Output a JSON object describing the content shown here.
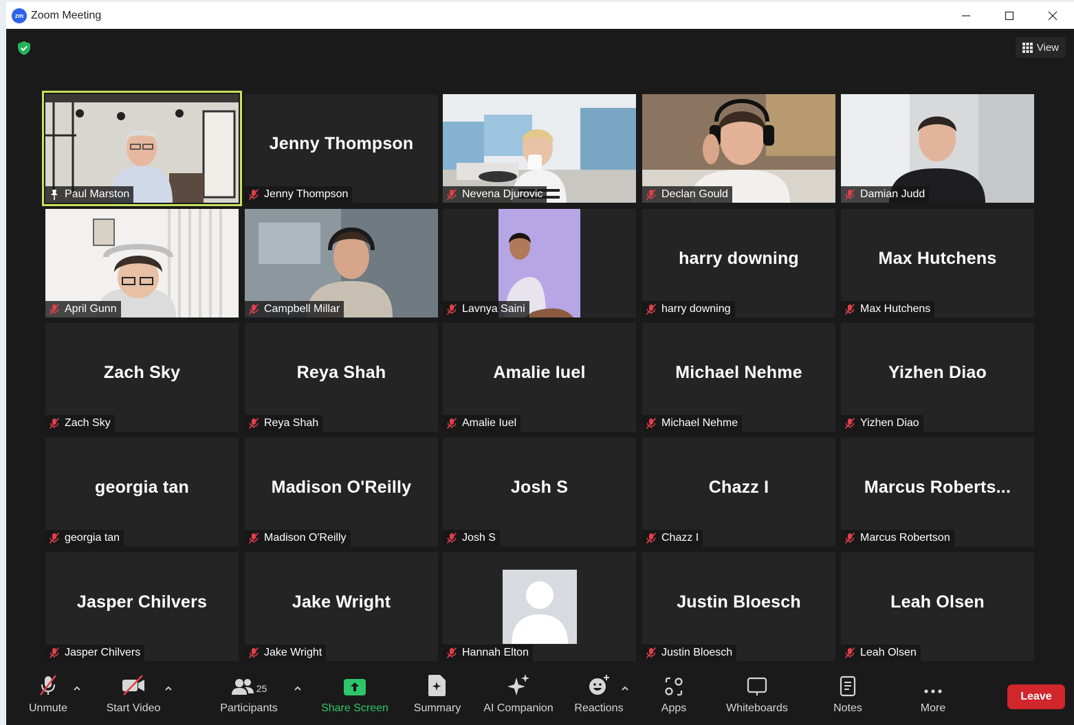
{
  "window": {
    "title": "Zoom Meeting"
  },
  "view_button": {
    "label": "View"
  },
  "participants_grid": [
    {
      "display": "",
      "label": "Paul Marston",
      "video": "room",
      "pinned": true,
      "active": true
    },
    {
      "display": "Jenny Thompson",
      "label": "Jenny Thompson",
      "video": "",
      "muted": true
    },
    {
      "display": "",
      "label": "Nevena Djurovic",
      "video": "bright",
      "muted": true
    },
    {
      "display": "",
      "label": "Declan Gould",
      "video": "warm",
      "muted": true
    },
    {
      "display": "",
      "label": "Damian Judd",
      "video": "grey",
      "muted": true
    },
    {
      "display": "",
      "label": "April Gunn",
      "video": "white",
      "muted": true
    },
    {
      "display": "",
      "label": "Campbell Millar",
      "video": "blur",
      "muted": true
    },
    {
      "display": "",
      "label": "Lavnya Saini",
      "video": "portrait",
      "muted": true
    },
    {
      "display": "harry downing",
      "label": "harry downing",
      "video": "",
      "muted": true
    },
    {
      "display": "Max Hutchens",
      "label": "Max Hutchens",
      "video": "",
      "muted": true
    },
    {
      "display": "Zach Sky",
      "label": "Zach Sky",
      "video": "",
      "muted": true
    },
    {
      "display": "Reya Shah",
      "label": "Reya Shah",
      "video": "",
      "muted": true
    },
    {
      "display": "Amalie Iuel",
      "label": "Amalie Iuel",
      "video": "",
      "muted": true
    },
    {
      "display": "Michael Nehme",
      "label": "Michael Nehme",
      "video": "",
      "muted": true
    },
    {
      "display": "Yizhen Diao",
      "label": "Yizhen Diao",
      "video": "",
      "muted": true
    },
    {
      "display": "georgia tan",
      "label": "georgia tan",
      "video": "",
      "muted": true
    },
    {
      "display": "Madison O'Reilly",
      "label": "Madison O'Reilly",
      "video": "",
      "muted": true
    },
    {
      "display": "Josh S",
      "label": "Josh S",
      "video": "",
      "muted": true
    },
    {
      "display": "Chazz I",
      "label": "Chazz I",
      "video": "",
      "muted": true
    },
    {
      "display": "Marcus Roberts...",
      "label": "Marcus Robertson",
      "video": "",
      "muted": true
    },
    {
      "display": "Jasper Chilvers",
      "label": "Jasper Chilvers",
      "video": "",
      "muted": true
    },
    {
      "display": "Jake Wright",
      "label": "Jake Wright",
      "video": "",
      "muted": true
    },
    {
      "display": "",
      "label": "Hannah Elton",
      "video": "avatar",
      "muted": true
    },
    {
      "display": "Justin Bloesch",
      "label": "Justin Bloesch",
      "video": "",
      "muted": true
    },
    {
      "display": "Leah Olsen",
      "label": "Leah Olsen",
      "video": "",
      "muted": true
    }
  ],
  "toolbar": {
    "unmute": "Unmute",
    "start_video": "Start Video",
    "participants": "Participants",
    "participant_count": "25",
    "share_screen": "Share Screen",
    "summary": "Summary",
    "ai_companion": "AI Companion",
    "reactions": "Reactions",
    "apps": "Apps",
    "whiteboards": "Whiteboards",
    "notes": "Notes",
    "more": "More",
    "leave": "Leave"
  },
  "colors": {
    "active_speaker": "#c8e05a",
    "share": "#2fc56b",
    "leave": "#d0262c",
    "mute": "#e0404a"
  }
}
